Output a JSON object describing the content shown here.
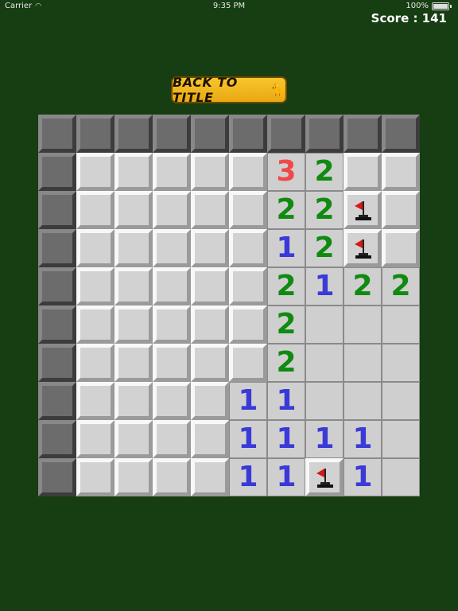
{
  "status_bar": {
    "carrier": "Carrier",
    "time": "9:35 PM",
    "battery": "100%"
  },
  "score_text": "Score : 141",
  "back_button": {
    "label": "BACK TO TITLE"
  },
  "colors": {
    "1": "#3a3ad8",
    "2": "#108a10",
    "3": "#f04848"
  },
  "board": [
    [
      "D",
      "D",
      "D",
      "D",
      "D",
      "D",
      "D",
      "D",
      "D",
      "D"
    ],
    [
      "D",
      "L",
      "L",
      "L",
      "L",
      "L",
      "3",
      "2",
      "L",
      "L"
    ],
    [
      "D",
      "L",
      "L",
      "L",
      "L",
      "L",
      "2",
      "2",
      "F",
      "L"
    ],
    [
      "D",
      "L",
      "L",
      "L",
      "L",
      "L",
      "1",
      "2",
      "F",
      "L"
    ],
    [
      "D",
      "L",
      "L",
      "L",
      "L",
      "L",
      "2",
      "1",
      "2",
      "2"
    ],
    [
      "D",
      "L",
      "L",
      "L",
      "L",
      "L",
      "2",
      "O",
      "O",
      "O"
    ],
    [
      "D",
      "L",
      "L",
      "L",
      "L",
      "L",
      "2",
      "O",
      "O",
      "O"
    ],
    [
      "D",
      "L",
      "L",
      "L",
      "L",
      "1",
      "1",
      "O",
      "O",
      "O"
    ],
    [
      "D",
      "L",
      "L",
      "L",
      "L",
      "1",
      "1",
      "1",
      "1",
      "O"
    ],
    [
      "D",
      "L",
      "L",
      "L",
      "L",
      "1",
      "1",
      "F",
      "1",
      "O"
    ]
  ]
}
